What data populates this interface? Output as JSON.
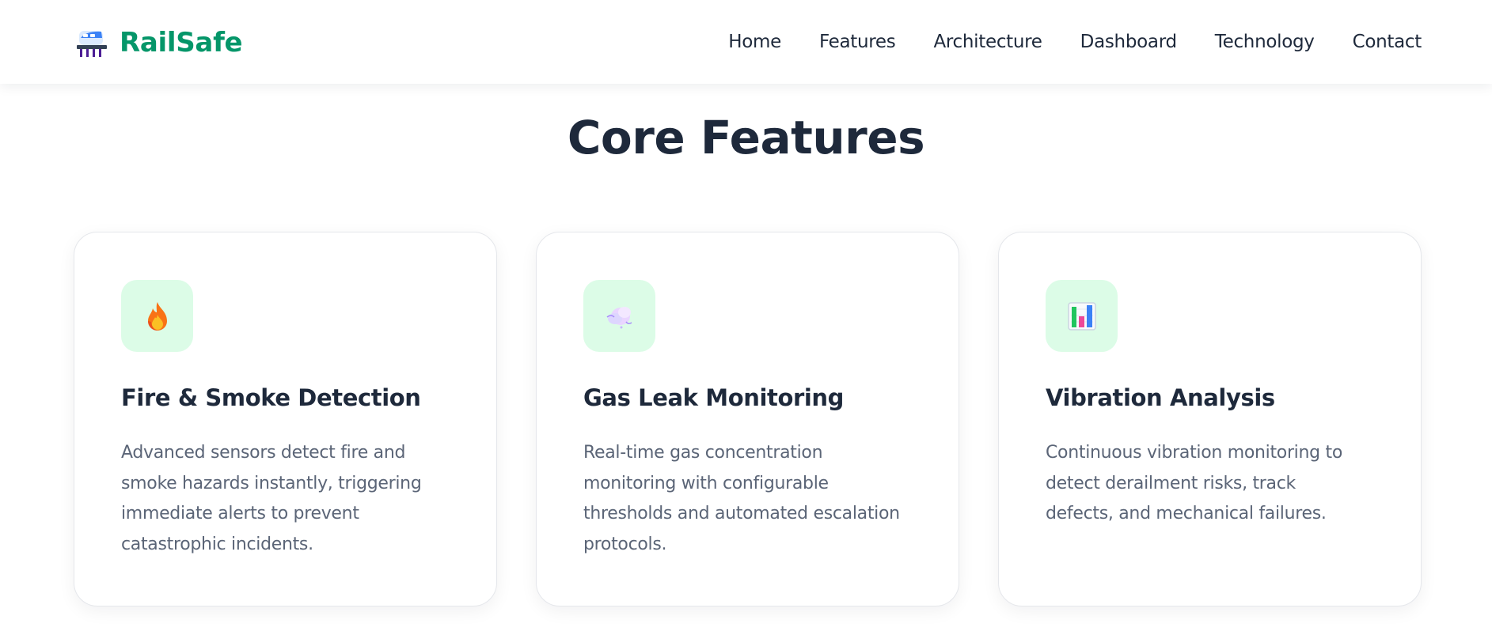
{
  "brand": {
    "name": "RailSafe",
    "icon": "train-icon",
    "accent_color": "#059669"
  },
  "nav": {
    "links": [
      {
        "label": "Home"
      },
      {
        "label": "Features"
      },
      {
        "label": "Architecture"
      },
      {
        "label": "Dashboard"
      },
      {
        "label": "Technology"
      },
      {
        "label": "Contact"
      }
    ]
  },
  "section": {
    "title": "Core Features"
  },
  "features": [
    {
      "icon": "fire-icon",
      "title": "Fire & Smoke Detection",
      "description": "Advanced sensors detect fire and smoke hazards instantly, triggering immediate alerts to prevent catastrophic incidents."
    },
    {
      "icon": "gas-cloud-icon",
      "title": "Gas Leak Monitoring",
      "description": "Real-time gas concentration monitoring with configurable thresholds and automated escalation protocols."
    },
    {
      "icon": "bar-chart-icon",
      "title": "Vibration Analysis",
      "description": "Continuous vibration monitoring to detect derailment risks, track defects, and mechanical failures."
    }
  ],
  "colors": {
    "icon_tile_bg": "#dcfce7",
    "text_dark": "#1e293b",
    "text_muted": "#5b6577"
  }
}
